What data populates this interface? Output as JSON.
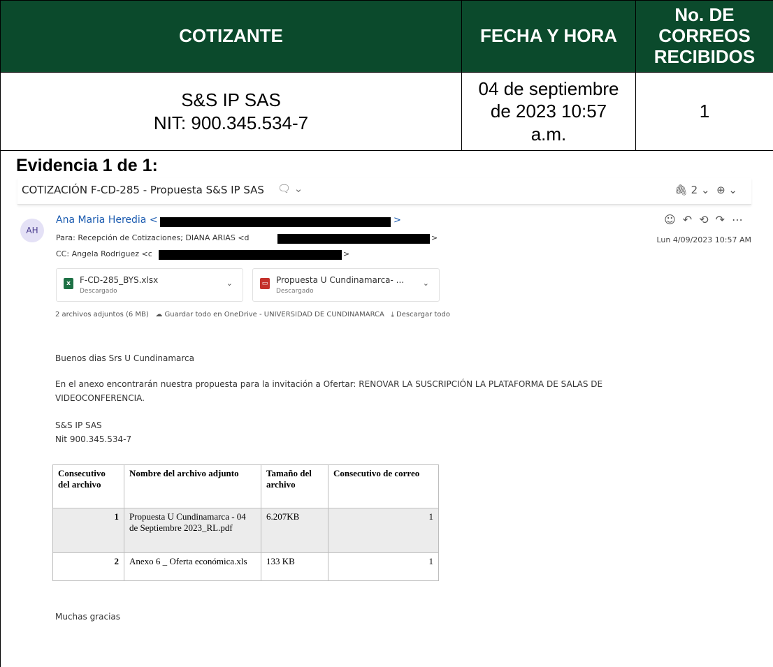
{
  "header": {
    "col1": "COTIZANTE",
    "col2": "FECHA Y HORA",
    "col3": "No. DE CORREOS RECIBIDOS"
  },
  "row": {
    "cotizante_name": "S&S IP SAS",
    "cotizante_nit": "NIT: 900.345.534-7",
    "fecha": "04 de septiembre de 2023 10:57 a.m.",
    "correos": "1"
  },
  "evidence_title": "Evidencia 1 de 1:",
  "email": {
    "subject": "COTIZACIÓN F-CD-285 - Propuesta S&S IP SAS",
    "attachment_count": "2",
    "avatar_initials": "AH",
    "sender": "Ana Maria Heredia <",
    "to_prefix": "Para: Recepción de Cotizaciones; DIANA ARIAS <d",
    "cc_prefix": "CC: Angela Rodriguez <c",
    "date": "Lun 4/09/2023 10:57 AM",
    "attachments": [
      {
        "name": "F-CD-285_BYS.xlsx",
        "status": "Descargado",
        "type": "excel"
      },
      {
        "name": "Propuesta U Cundinamarca- ...",
        "status": "Descargado",
        "type": "pdf"
      }
    ],
    "attach_summary": "2 archivos adjuntos (6 MB)",
    "save_onedrive": "Guardar todo en OneDrive - UNIVERSIDAD DE CUNDINAMARCA",
    "download_all": "Descargar todo",
    "greeting": "Buenos dias Srs U Cundinamarca",
    "paragraph_line1": "En el anexo encontrarán nuestra propuesta para la invitación a Ofertar: RENOVAR LA SUSCRIPCIÓN LA PLATAFORMA DE SALAS DE",
    "paragraph_line2": "VIDEOCONFERENCIA.",
    "signature_name": "S&S IP SAS",
    "signature_nit": "Nit 900.345.534-7",
    "closing": "Muchas gracias",
    "table": {
      "headers": [
        "Consecutivo del archivo",
        "Nombre del archivo adjunto",
        "Tamaño del archivo",
        "Consecutivo de correo"
      ],
      "rows": [
        [
          "1",
          "Propuesta  U Cundinamarca - 04 de Septiembre 2023_RL.pdf",
          "6.207KB",
          "1"
        ],
        [
          "2",
          "Anexo 6 _ Oferta económica.xls",
          "133 KB",
          "1"
        ]
      ]
    }
  }
}
